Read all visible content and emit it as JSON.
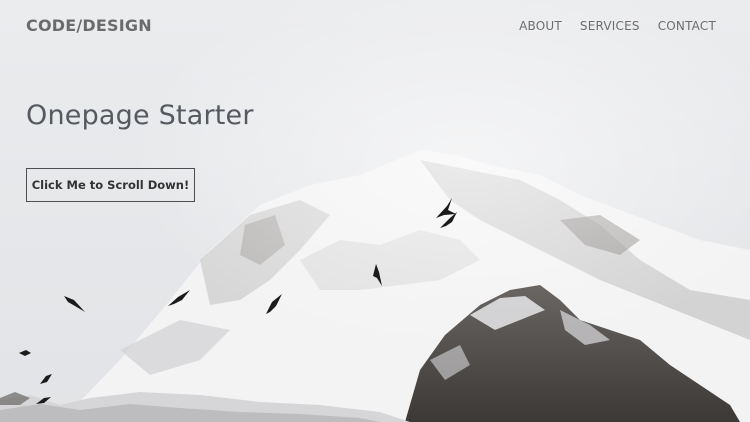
{
  "header": {
    "brand": "CODE/DESIGN",
    "nav": [
      {
        "label": "ABOUT"
      },
      {
        "label": "SERVICES"
      },
      {
        "label": "CONTACT"
      }
    ]
  },
  "hero": {
    "title": "Onepage Starter",
    "cta_label": "Click Me to Scroll Down!",
    "background": "misty snowy mountain with flying birds"
  },
  "colors": {
    "brand_text": "#6b6b6b",
    "nav_text": "#6d6d6d",
    "title_text": "#555a60",
    "button_border": "#4e4e4e",
    "sky": "#e9eaec"
  }
}
